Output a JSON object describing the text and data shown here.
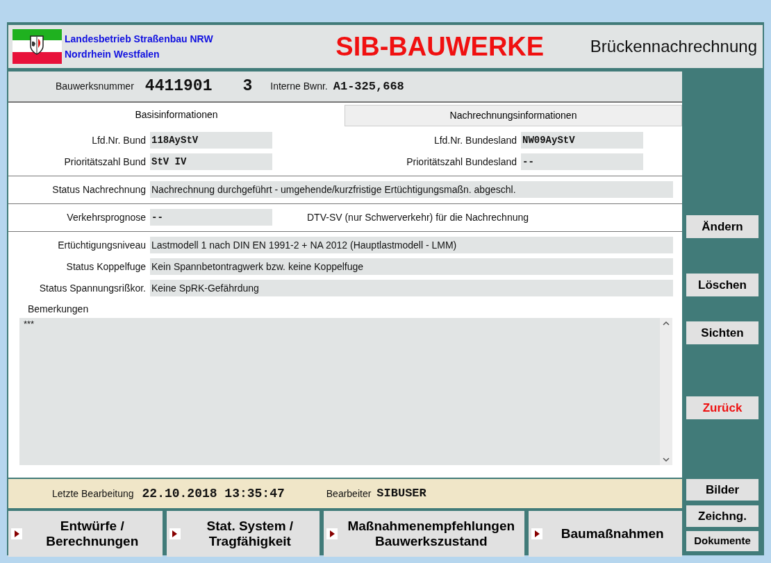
{
  "header": {
    "org_lines": [
      "Landesbetrieb Straßenbau NRW",
      "Nordrhein Westfalen"
    ],
    "app_title": "SIB-BAUWERKE",
    "module_title": "Brückennachrechnung"
  },
  "id_bar": {
    "number_label": "Bauwerksnummer",
    "number": "4411901",
    "part": "3",
    "internal_label": "Interne Bwnr.",
    "internal": "A1-325,668"
  },
  "tabs": [
    {
      "label": "Basisinformationen",
      "selected": true
    },
    {
      "label": "Nachrechnungsinformationen",
      "selected": false
    }
  ],
  "pair_rows": [
    {
      "left": {
        "label": "Lfd.Nr. Bund",
        "value": "118AyStV"
      },
      "right": {
        "label": "Lfd.Nr. Bundesland",
        "value": "NW09AyStV"
      }
    },
    {
      "left": {
        "label": "Prioritätszahl Bund",
        "value": "StV IV"
      },
      "right": {
        "label": "Prioritätszahl Bundesland",
        "value": "--"
      }
    }
  ],
  "status_row": {
    "label": "Status Nachrechnung",
    "value": "Nachrechnung durchgeführt - umgehende/kurzfristige Ertüchtigungsmaßn. abgeschl."
  },
  "traffic_row": {
    "label": "Verkehrsprognose",
    "value": "--",
    "note": "DTV-SV (nur Schwerverkehr) für die Nachrechnung"
  },
  "detail_rows": [
    {
      "label": "Ertüchtigungsniveau",
      "value": "Lastmodell 1 nach DIN EN 1991-2 + NA 2012 (Hauptlastmodell - LMM)"
    },
    {
      "label": "Status Koppelfuge",
      "value": "Kein Spannbetontragwerk bzw. keine Koppelfuge"
    },
    {
      "label": "Status Spannungsrißkor.",
      "value": "Keine SpRK-Gefährdung"
    }
  ],
  "remarks": {
    "label": "Bemerkungen",
    "value": "***"
  },
  "footer": {
    "edit_label": "Letzte Bearbeitung",
    "edit_value": "22.10.2018 13:35:47",
    "editor_label": "Bearbeiter",
    "editor_value": "SIBUSER"
  },
  "nav_buttons": [
    {
      "lines": [
        "Entwürfe /",
        "Berechnungen"
      ]
    },
    {
      "lines": [
        "Stat. System /",
        "Tragfähigkeit"
      ]
    },
    {
      "lines": [
        "Maßnahmenempfehlungen",
        "Bauwerkszustand"
      ]
    },
    {
      "lines": [
        "Baumaßnahmen"
      ]
    }
  ],
  "side_buttons": [
    {
      "label": "Ändern",
      "kind": "action"
    },
    {
      "label": "Löschen",
      "kind": "action"
    },
    {
      "label": "Sichten",
      "kind": "action"
    },
    {
      "label": "Zurück",
      "kind": "back"
    },
    {
      "label": "Bilder",
      "kind": "media"
    },
    {
      "label": "Zeichng.",
      "kind": "media"
    },
    {
      "label": "Dokumente",
      "kind": "media"
    }
  ]
}
